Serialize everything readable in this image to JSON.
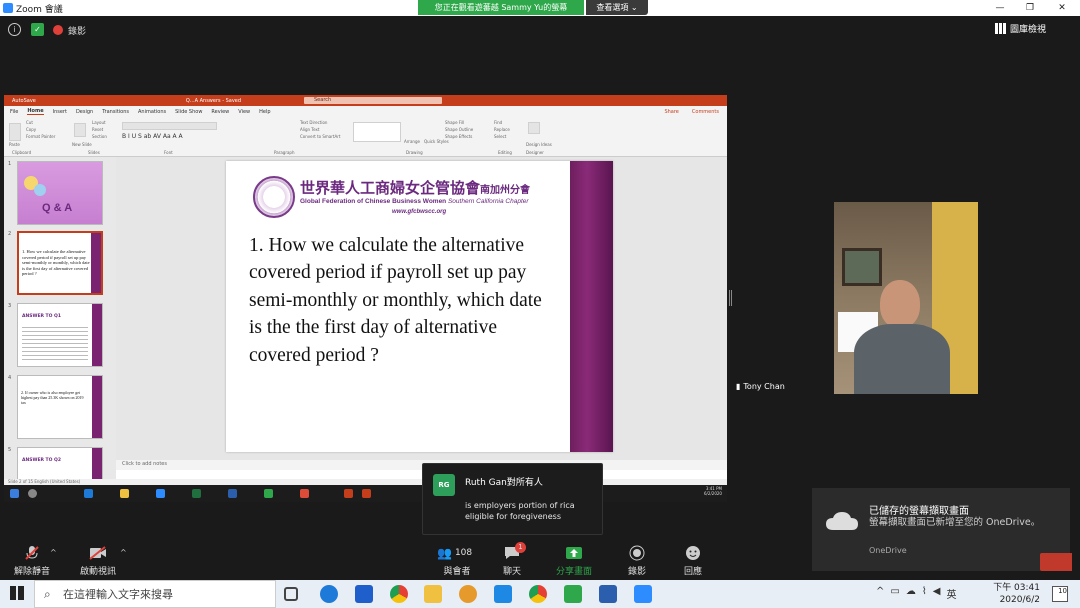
{
  "window": {
    "app_title": "Zoom 會議",
    "minimize": "—",
    "maximize": "❐",
    "close": "✕"
  },
  "banner": {
    "viewing_text": "您正在觀看遊蕃越 Sammy Yu的螢幕",
    "view_options": "查看選項 ⌄"
  },
  "top_status": {
    "recording_label": "錄影",
    "gallery_label": "圖庫檢視"
  },
  "powerpoint": {
    "title": "Q...A Answers - Saved",
    "autosave": "AutoSave",
    "search_placeholder": "Search",
    "tabs": [
      "File",
      "Home",
      "Insert",
      "Design",
      "Transitions",
      "Animations",
      "Slide Show",
      "Review",
      "View",
      "Help"
    ],
    "share": "Share",
    "comments": "Comments",
    "ribbon_groups": [
      "Clipboard",
      "Slides",
      "Font",
      "Paragraph",
      "Drawing",
      "Editing",
      "Designer"
    ],
    "ribbon_items": [
      "Paste",
      "Cut",
      "Copy",
      "Format Painter",
      "New Slide",
      "Layout",
      "Reset",
      "Section",
      "Text Direction",
      "Align Text",
      "Convert to SmartArt",
      "Arrange",
      "Quick Styles",
      "Shape Fill",
      "Shape Outline",
      "Shape Effects",
      "Find",
      "Replace",
      "Select",
      "Design Ideas"
    ],
    "thumbnails": [
      {
        "num": "1",
        "label": "Q & A"
      },
      {
        "num": "2",
        "label": "1. How we calculate the alternative covered period if payroll set up pay semi-monthly or monthly, which date is the first day of alternative covered period ?"
      },
      {
        "num": "3",
        "label": "ANSWER TO Q1"
      },
      {
        "num": "4",
        "label": "2. If owner who is also employee get highest pay than 25.3K shown on 2019 tax"
      },
      {
        "num": "5",
        "label": "ANSWER TO Q2"
      }
    ],
    "notes_placeholder": "Click to add notes",
    "status_text": "Slide 2 of 15     English (United States)",
    "slide": {
      "org_name_cn": "世界華人工商婦女企管協會",
      "org_chapter_cn": "南加州分會",
      "org_name_en": "Global Federation of Chinese Business Women",
      "org_chapter_en": "Southern California Chapter",
      "org_url": "www.gfcbwscc.org",
      "question": "1. How we calculate the alternative covered period if payroll set up pay semi-monthly or monthly, which date is the the first day of alternative covered period ?"
    },
    "taskbar_time": "3:41 PM",
    "taskbar_date": "6/2/2020"
  },
  "chat_popup": {
    "avatar": "RG",
    "from": "Ruth Gan對所有人",
    "message": "is employers portion of rica eligible for foregiveness"
  },
  "video": {
    "participant": "Tony Chan"
  },
  "onedrive_toast": {
    "title": "已儲存的螢幕擷取畫面",
    "body": "螢幕擷取畫面已新增至您的 OneDrive。",
    "source": "OneDrive"
  },
  "toolbar": {
    "unmute": "解除靜音",
    "start_video": "啟動視訊",
    "participants": "與會者",
    "participants_count": "108",
    "chat": "聊天",
    "chat_badge": "1",
    "share_screen": "分享畫面",
    "record": "錄影",
    "reactions": "回應"
  },
  "windows": {
    "search_placeholder": "在這裡輸入文字來搜尋",
    "clock_time": "下午 03:41",
    "clock_date": "2020/6/2",
    "ime": "英",
    "notifications": "10"
  },
  "colors": {
    "zoom_blue": "#2d8cff",
    "banner_green": "#2ea84a",
    "ppt_red": "#c43e1c",
    "slide_purple": "#6b2a7f"
  }
}
